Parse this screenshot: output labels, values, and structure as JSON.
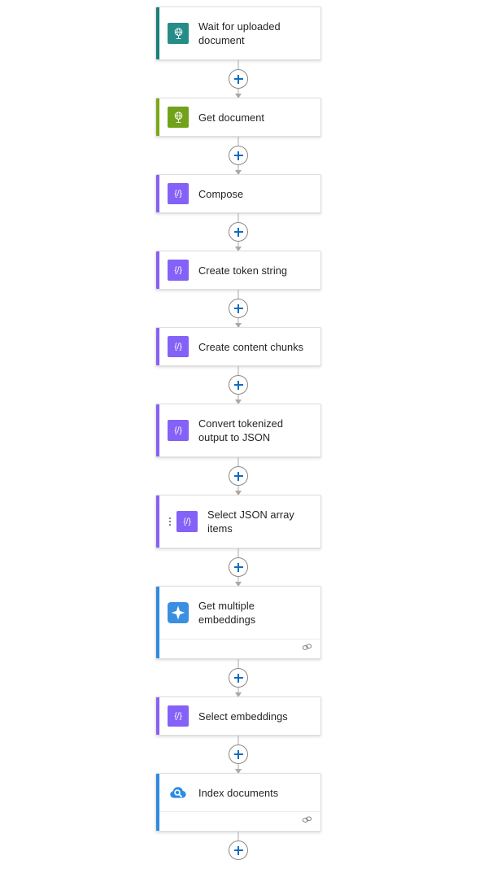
{
  "app": {
    "surface": "workflow-designer-canvas",
    "background_color": "#ffffff",
    "text_color": "#242424",
    "card_border_color": "#e1dfdd",
    "connector_line_color": "#a9a9a9",
    "plus_accent_color": "#0f6cbd"
  },
  "add_action": {
    "label": "+",
    "tooltip": "Insert a new step"
  },
  "nodes": [
    {
      "title": "Wait for uploaded document",
      "icon": "sharepoint-globe-icon",
      "icon_glyph": "globe",
      "icon_bg": "#268c87",
      "accent_color": "#1b7f7a",
      "lines": 2,
      "has_drag_handle": false,
      "has_footer": false,
      "footer_icon": ""
    },
    {
      "title": "Get document",
      "icon": "sharepoint-globe-icon",
      "icon_glyph": "globe",
      "icon_bg": "#71a21a",
      "accent_color": "#7aa818",
      "lines": 1,
      "has_drag_handle": false,
      "has_footer": false,
      "footer_icon": ""
    },
    {
      "title": "Compose",
      "icon": "data-operations-icon",
      "icon_glyph": "{/}",
      "icon_bg": "#8461f7",
      "accent_color": "#8661f5",
      "lines": 1,
      "has_drag_handle": false,
      "has_footer": false,
      "footer_icon": ""
    },
    {
      "title": "Create token string",
      "icon": "data-operations-icon",
      "icon_glyph": "{/}",
      "icon_bg": "#8461f7",
      "accent_color": "#8661f5",
      "lines": 1,
      "has_drag_handle": false,
      "has_footer": false,
      "footer_icon": ""
    },
    {
      "title": "Create content chunks",
      "icon": "data-operations-icon",
      "icon_glyph": "{/}",
      "icon_bg": "#8461f7",
      "accent_color": "#8661f5",
      "lines": 1,
      "has_drag_handle": false,
      "has_footer": false,
      "footer_icon": ""
    },
    {
      "title": "Convert tokenized output to JSON",
      "icon": "data-operations-icon",
      "icon_glyph": "{/}",
      "icon_bg": "#8461f7",
      "accent_color": "#8661f5",
      "lines": 2,
      "has_drag_handle": false,
      "has_footer": false,
      "footer_icon": ""
    },
    {
      "title": "Select JSON array items",
      "icon": "data-operations-icon",
      "icon_glyph": "{/}",
      "icon_bg": "#8461f7",
      "accent_color": "#8661f5",
      "lines": 2,
      "has_drag_handle": true,
      "has_footer": false,
      "footer_icon": ""
    },
    {
      "title": "Get multiple embeddings",
      "icon": "azure-openai-sparkle-icon",
      "icon_glyph": "sparkle",
      "icon_bg": "#3a8fe0",
      "accent_color": "#2f8ae0",
      "lines": 2,
      "has_drag_handle": false,
      "has_footer": true,
      "footer_icon": "connection-link-icon"
    },
    {
      "title": "Select embeddings",
      "icon": "data-operations-icon",
      "icon_glyph": "{/}",
      "icon_bg": "#8461f7",
      "accent_color": "#8661f5",
      "lines": 1,
      "has_drag_handle": false,
      "has_footer": false,
      "footer_icon": ""
    },
    {
      "title": "Index documents",
      "icon": "azure-ai-search-cloud-icon",
      "icon_glyph": "cloud-search",
      "icon_bg": "transparent",
      "accent_color": "#2f8ae0",
      "lines": 1,
      "has_drag_handle": false,
      "has_footer": true,
      "footer_icon": "connection-link-icon"
    }
  ]
}
